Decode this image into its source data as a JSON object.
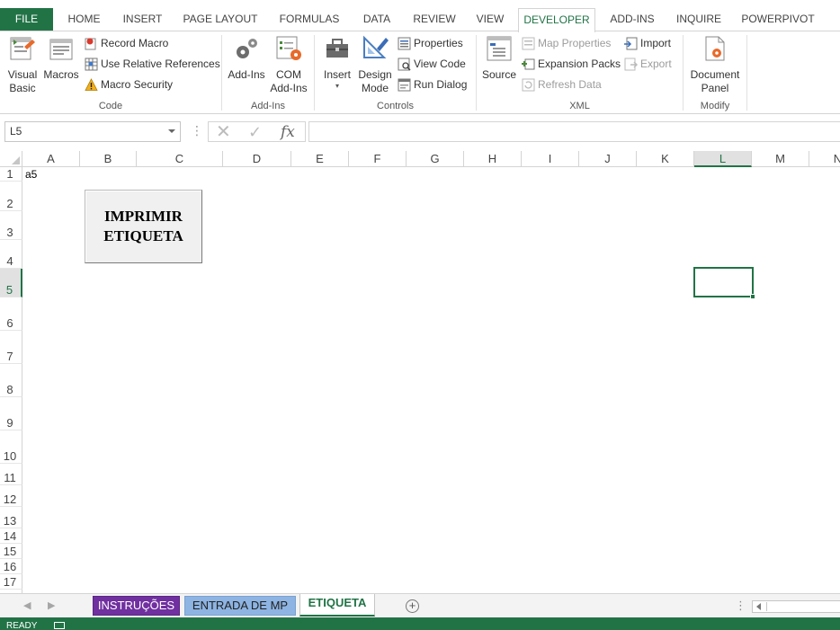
{
  "ribbon_tabs": [
    "FILE",
    "HOME",
    "INSERT",
    "PAGE LAYOUT",
    "FORMULAS",
    "DATA",
    "REVIEW",
    "VIEW",
    "DEVELOPER",
    "ADD-INS",
    "INQUIRE",
    "POWERPIVOT"
  ],
  "active_tab": "DEVELOPER",
  "groups": {
    "code": {
      "label": "Code",
      "visual_basic": "Visual\nBasic",
      "macros": "Macros",
      "record_macro": "Record Macro",
      "relative_refs": "Use Relative References",
      "macro_security": "Macro Security"
    },
    "addins": {
      "label": "Add-Ins",
      "add_ins": "Add-Ins",
      "com_add_ins": "COM\nAdd-Ins"
    },
    "controls": {
      "label": "Controls",
      "insert": "Insert",
      "design_mode": "Design\nMode",
      "properties": "Properties",
      "view_code": "View Code",
      "run_dialog": "Run Dialog"
    },
    "xml": {
      "label": "XML",
      "source": "Source",
      "map_properties": "Map Properties",
      "expansion_packs": "Expansion Packs",
      "refresh_data": "Refresh Data",
      "import": "Import",
      "export": "Export"
    },
    "modify": {
      "label": "Modify",
      "document_panel": "Document\nPanel"
    }
  },
  "formula_bar": {
    "name_box": "L5",
    "fx": "fx",
    "formula": ""
  },
  "columns": [
    "A",
    "B",
    "C",
    "D",
    "E",
    "F",
    "G",
    "H",
    "I",
    "J",
    "K",
    "L",
    "M",
    "N"
  ],
  "selected_column": "L",
  "rows": [
    "1",
    "2",
    "3",
    "4",
    "5",
    "6",
    "7",
    "8",
    "9",
    "10",
    "11",
    "12",
    "13",
    "14",
    "15",
    "16",
    "17"
  ],
  "selected_row": "5",
  "cells": {
    "A1": "a5"
  },
  "macro_button": {
    "label": "IMPRIMIR\nETIQUETA"
  },
  "sheet_tabs": [
    {
      "name": "INSTRUÇÕES",
      "color": "#7030a0"
    },
    {
      "name": "ENTRADA DE MP",
      "color": "#8db4e2"
    },
    {
      "name": "ETIQUETA",
      "color": "#ffffff"
    }
  ],
  "active_sheet": "ETIQUETA",
  "status": {
    "text": "READY"
  },
  "colors": {
    "accent": "#217346"
  }
}
